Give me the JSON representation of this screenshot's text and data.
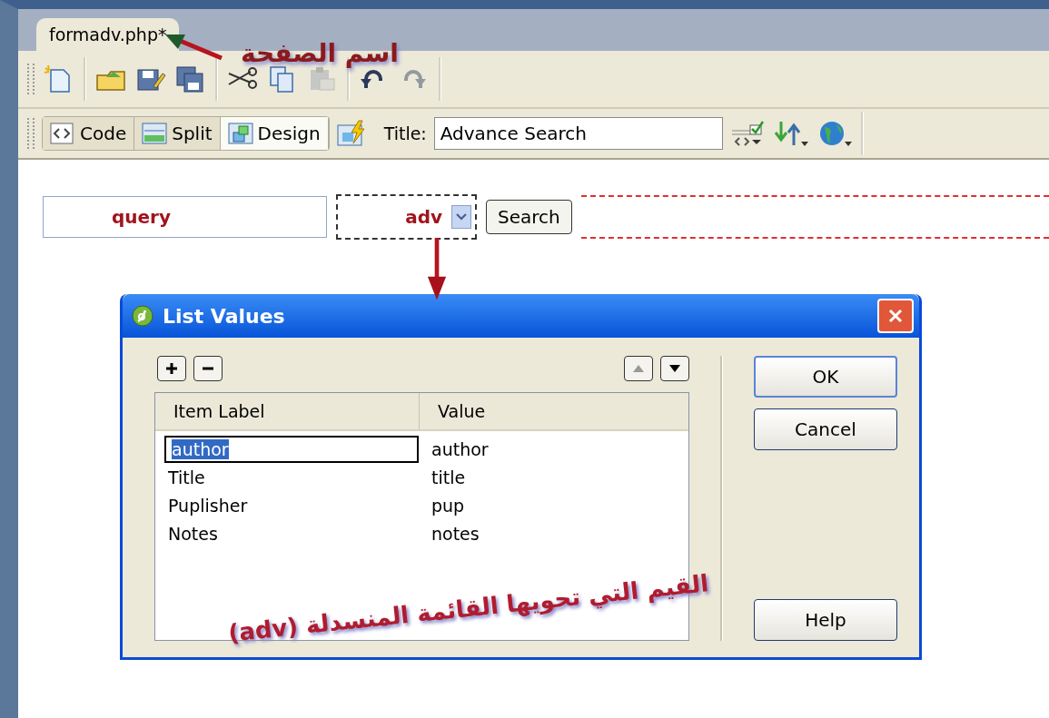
{
  "document_tab": {
    "label": "formadv.php*",
    "selected": true
  },
  "toolbar": [
    {
      "kind": "new",
      "disabled": false
    },
    {
      "kind": "sep"
    },
    {
      "kind": "open",
      "disabled": false
    },
    {
      "kind": "edit",
      "disabled": false
    },
    {
      "kind": "saveall",
      "disabled": false
    },
    {
      "kind": "sep"
    },
    {
      "kind": "cut",
      "disabled": false
    },
    {
      "kind": "copy",
      "disabled": false
    },
    {
      "kind": "paste",
      "disabled": true
    },
    {
      "kind": "sep"
    },
    {
      "kind": "undo",
      "disabled": false
    },
    {
      "kind": "redo",
      "disabled": true
    }
  ],
  "view_buttons": [
    {
      "label": "Code",
      "kind": "code",
      "selected": false
    },
    {
      "label": "Split",
      "kind": "split",
      "selected": false
    },
    {
      "label": "Design",
      "kind": "design",
      "selected": true
    }
  ],
  "title_field": {
    "label": "Title:",
    "value": "Advance Search"
  },
  "form": {
    "text_field": {
      "value": "query"
    },
    "select": {
      "value": "adv"
    },
    "button": "Search"
  },
  "dialog": {
    "title": "List Values",
    "columns": [
      "Item Label",
      "Value"
    ],
    "rows": [
      {
        "label": "author",
        "value": "author",
        "selected": true
      },
      {
        "label": "Title",
        "value": "title",
        "selected": false
      },
      {
        "label": "Puplisher",
        "value": "pup",
        "selected": false
      },
      {
        "label": "Notes",
        "value": "notes",
        "selected": false
      }
    ],
    "buttons": [
      "OK",
      "Cancel",
      "Help"
    ]
  },
  "annotations": [
    {
      "kind": "tab",
      "text": "اسم الصفحة"
    },
    {
      "kind": "list",
      "text": "القيم التي تحويها القائمة المنسدلة (adv)"
    }
  ]
}
